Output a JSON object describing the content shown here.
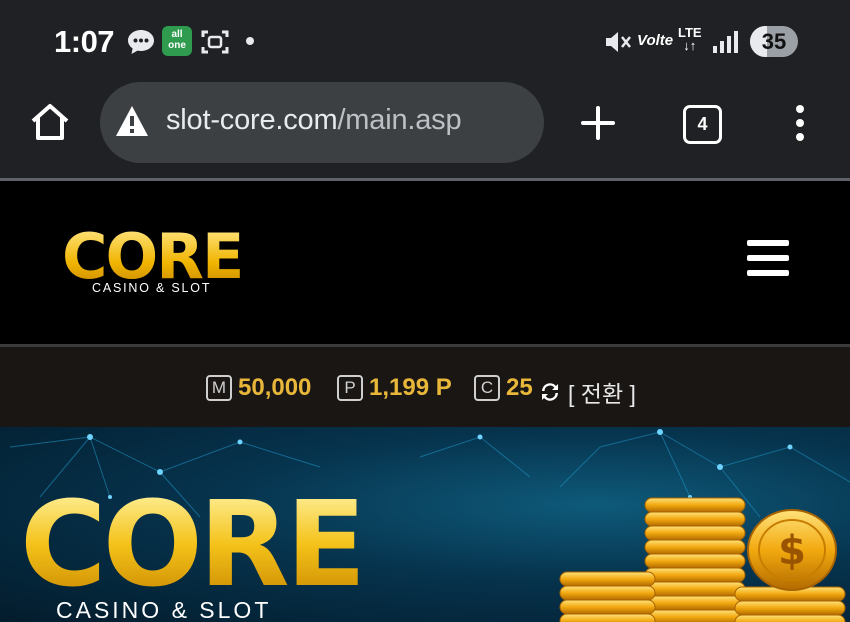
{
  "status_bar": {
    "time": "1:07",
    "allone_line1": "all",
    "allone_line2": "one",
    "volte": "Volte",
    "lte_line1": "LTE",
    "lte_line2": "↓↑",
    "battery": "35",
    "battery_level": 0.35
  },
  "browser": {
    "url_domain": "slot-core.com",
    "url_path": "/main.asp",
    "tab_count": "4"
  },
  "site": {
    "logo_word": "CORE",
    "logo_sub": "CASINO & SLOT"
  },
  "balance": {
    "money_icon": "M",
    "money_value": "50,000",
    "point_icon": "P",
    "point_value": "1,199 P",
    "coin_icon": "C",
    "coin_value": "25",
    "switch_label": "[ 전환 ]"
  },
  "banner": {
    "logo_word": "CORE",
    "logo_sub": "CASINO & SLOT"
  },
  "colors": {
    "gold": "#e8b73a",
    "chrome_bg": "#202124",
    "url_bg": "#3c4043"
  }
}
